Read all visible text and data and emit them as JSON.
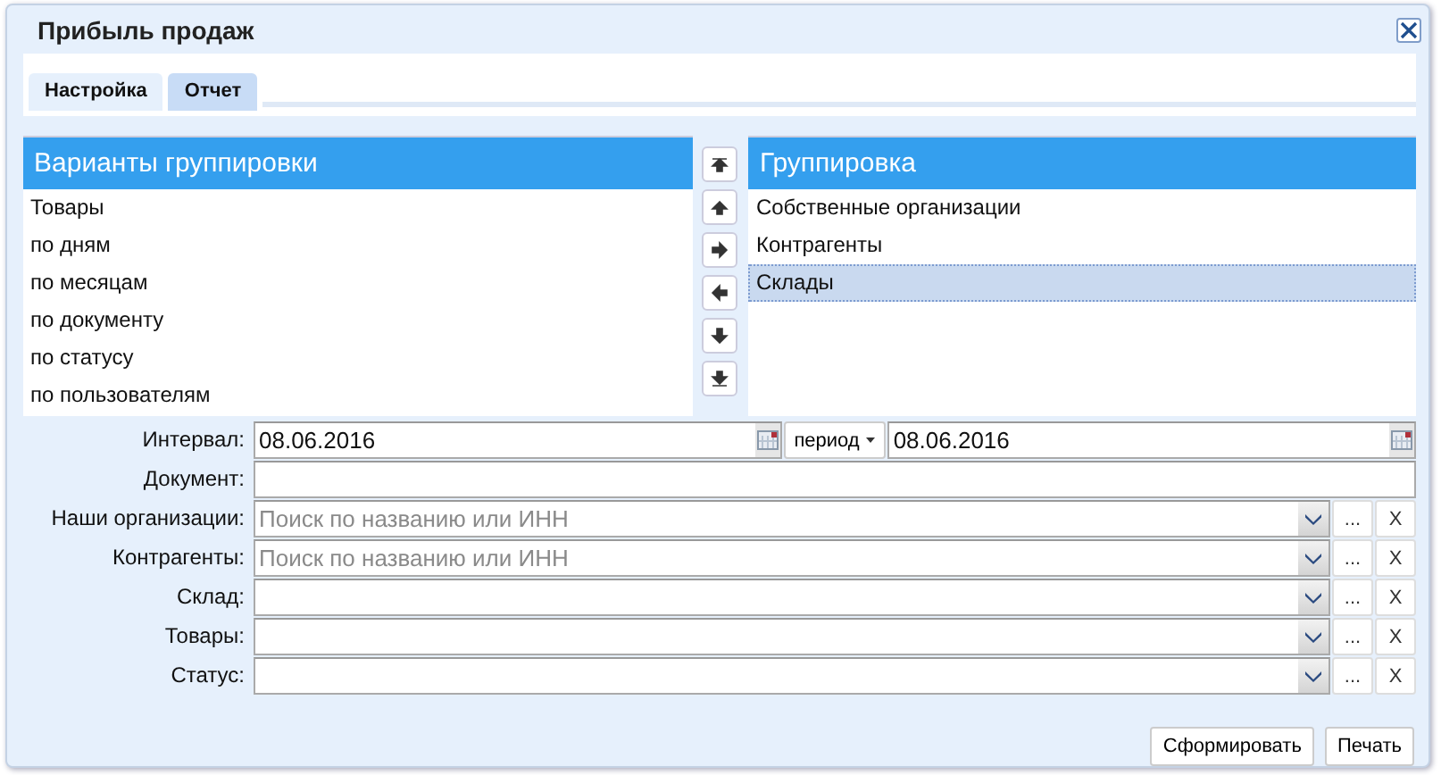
{
  "window": {
    "title": "Прибыль продаж"
  },
  "tabs": [
    {
      "label": "Настройка",
      "selected": false
    },
    {
      "label": "Отчет",
      "selected": true
    }
  ],
  "variants": {
    "title": "Варианты группировки",
    "items": [
      {
        "label": "Товары",
        "selected": false
      },
      {
        "label": "по дням",
        "selected": false
      },
      {
        "label": "по месяцам",
        "selected": false
      },
      {
        "label": "по документу",
        "selected": false
      },
      {
        "label": "по статусу",
        "selected": false
      },
      {
        "label": "по пользователям",
        "selected": false
      }
    ]
  },
  "grouping": {
    "title": "Группировка",
    "items": [
      {
        "label": "Собственные организации",
        "selected": false
      },
      {
        "label": "Контрагенты",
        "selected": false
      },
      {
        "label": "Склады",
        "selected": true
      }
    ]
  },
  "form": [
    {
      "kind": "interval",
      "label": "Интервал:",
      "from": "08.06.2016",
      "period": "период",
      "to": "08.06.2016"
    },
    {
      "kind": "text",
      "label": "Документ:"
    },
    {
      "kind": "combo",
      "label": "Наши организации:",
      "placeholder": "Поиск по названию или ИНН",
      "more": "...",
      "clear": "X"
    },
    {
      "kind": "combo",
      "label": "Контрагенты:",
      "placeholder": "Поиск по названию или ИНН",
      "more": "...",
      "clear": "X"
    },
    {
      "kind": "combo",
      "label": "Склад:",
      "more": "...",
      "clear": "X"
    },
    {
      "kind": "combo",
      "label": "Товары:",
      "more": "...",
      "clear": "X"
    },
    {
      "kind": "combo",
      "label": "Статус:",
      "more": "...",
      "clear": "X"
    }
  ],
  "buttons": [
    "Сформировать",
    "Печать"
  ]
}
